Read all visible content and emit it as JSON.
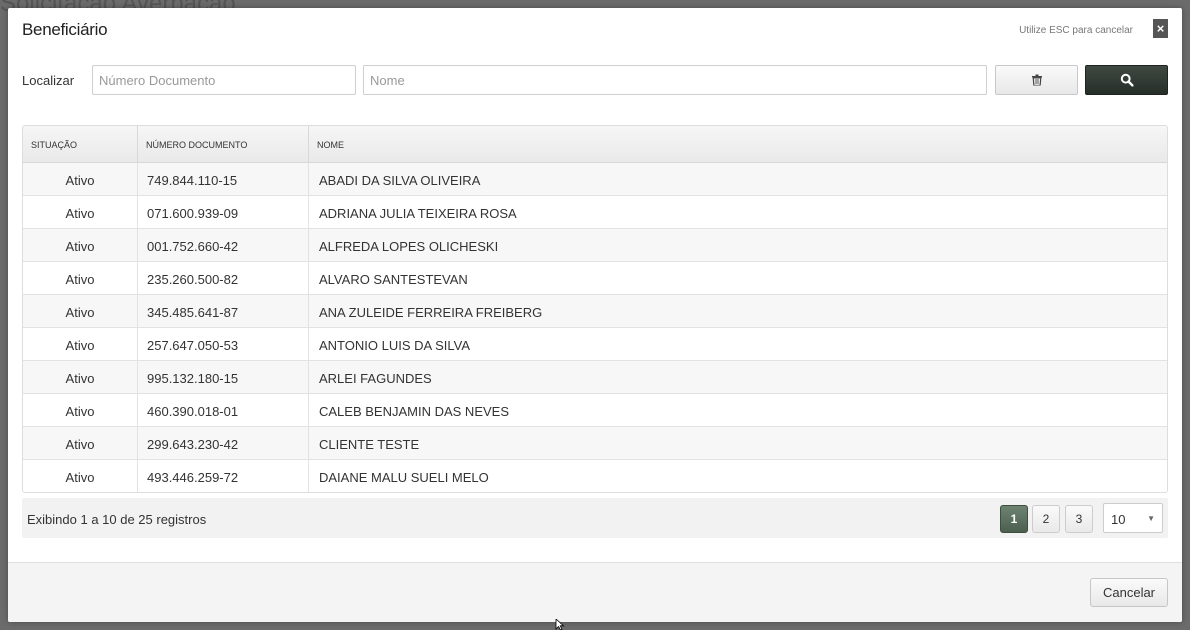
{
  "background": {
    "title": "Solicitação Averbação"
  },
  "modal": {
    "title": "Beneficiário",
    "esc_hint": "Utilize ESC para cancelar",
    "close_symbol": "×"
  },
  "search": {
    "label": "Localizar",
    "document_placeholder": "Número Documento",
    "name_placeholder": "Nome",
    "clear_icon": "trash-icon",
    "search_icon": "search-icon"
  },
  "table": {
    "columns": [
      "SITUAÇÃO",
      "NÚMERO DOCUMENTO",
      "NOME"
    ],
    "rows": [
      [
        "Ativo",
        "749.844.110-15",
        "ABADI DA SILVA OLIVEIRA"
      ],
      [
        "Ativo",
        "071.600.939-09",
        "ADRIANA JULIA TEIXEIRA ROSA"
      ],
      [
        "Ativo",
        "001.752.660-42",
        "ALFREDA LOPES OLICHESKI"
      ],
      [
        "Ativo",
        "235.260.500-82",
        "ALVARO SANTESTEVAN"
      ],
      [
        "Ativo",
        "345.485.641-87",
        "ANA ZULEIDE FERREIRA FREIBERG"
      ],
      [
        "Ativo",
        "257.647.050-53",
        "ANTONIO LUIS DA SILVA"
      ],
      [
        "Ativo",
        "995.132.180-15",
        "ARLEI FAGUNDES"
      ],
      [
        "Ativo",
        "460.390.018-01",
        "CALEB BENJAMIN DAS NEVES"
      ],
      [
        "Ativo",
        "299.643.230-42",
        "CLIENTE TESTE"
      ],
      [
        "Ativo",
        "493.446.259-72",
        "DAIANE MALU SUELI MELO"
      ]
    ]
  },
  "pagination": {
    "info": "Exibindo 1 a 10 de 25 registros",
    "pages": [
      "1",
      "2",
      "3"
    ],
    "active_page": "1",
    "page_size": "10"
  },
  "footer": {
    "cancel_label": "Cancelar"
  },
  "colors": {
    "primary_dark": "#2f3831",
    "active_page": "#5a6e5d"
  }
}
